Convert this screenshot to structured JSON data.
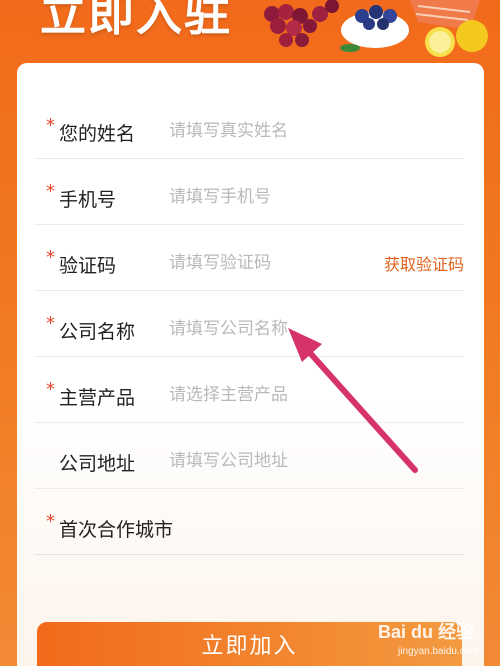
{
  "banner": {
    "title": "立即入驻"
  },
  "form": {
    "fields": [
      {
        "label": "您的姓名",
        "placeholder": "请填写真实姓名",
        "required": true
      },
      {
        "label": "手机号",
        "placeholder": "请填写手机号",
        "required": true
      },
      {
        "label": "验证码",
        "placeholder": "请填写验证码",
        "required": true,
        "action": "获取验证码"
      },
      {
        "label": "公司名称",
        "placeholder": "请填写公司名称",
        "required": true
      },
      {
        "label": "主营产品",
        "placeholder": "请选择主营产品",
        "required": true
      },
      {
        "label": "公司地址",
        "placeholder": "请填写公司地址",
        "required": false
      },
      {
        "label": "首次合作城市",
        "placeholder": "",
        "required": true
      }
    ],
    "required_mark": "*",
    "submit_label": "立即加入"
  },
  "watermark": {
    "brand": "Bai du 经验",
    "url": "jingyan.baidu.com"
  },
  "colors": {
    "accent": "#f26a1b",
    "required": "#e8462b",
    "link": "#e0621d",
    "annotation_arrow": "#d6336c"
  }
}
